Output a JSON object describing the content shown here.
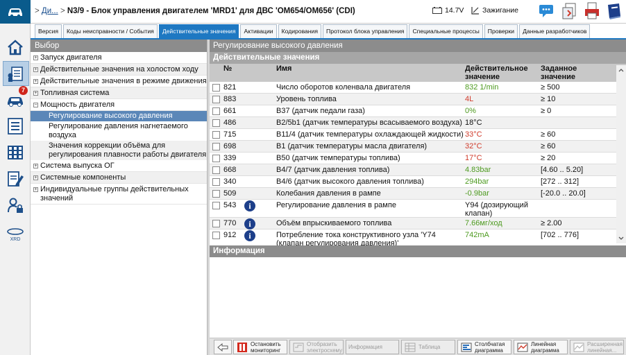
{
  "header": {
    "breadcrumb_sep": ">",
    "breadcrumb_link": "Ди...",
    "breadcrumb_sep2": ">",
    "title": "N3/9 - Блок управления двигателем 'MRD1' для ДВС 'OM654/OM656' (CDI)",
    "voltage": "14.7V",
    "ignition": "Зажигание"
  },
  "nav": {
    "badge_count": "7",
    "xrd_label": "XRD"
  },
  "tabs": [
    "Версия",
    "Коды неисправности / События",
    "Действительные значения",
    "Активации",
    "Кодирования",
    "Протокол блока управления",
    "Специальные процессы",
    "Проверки",
    "Данные разработчиков"
  ],
  "selection": {
    "title": "Выбор",
    "nodes": [
      {
        "label": "Запуск двигателя",
        "toggle": "+"
      },
      {
        "label": "Действительные значения на холостом ходу",
        "toggle": "+"
      },
      {
        "label": "Действительные значения в режиме движения",
        "toggle": "+"
      },
      {
        "label": "Топливная система",
        "toggle": "+"
      },
      {
        "label": "Мощность двигателя",
        "toggle": "−"
      }
    ],
    "children": [
      "Регулирование высокого давления",
      "Регулирование давления нагнетаемого воздуха",
      "Значения коррекции объёма для регулирования плавности работы двигателя"
    ],
    "nodes_after": [
      {
        "label": "Система выпуска ОГ",
        "toggle": "+"
      },
      {
        "label": "Системные компоненты",
        "toggle": "+"
      },
      {
        "label": "Индивидуальные группы действительных значений",
        "toggle": "+"
      }
    ]
  },
  "panel": {
    "title": "Регулирование высокого давления",
    "subtitle": "Действительные значения",
    "columns": {
      "num": "№",
      "name": "Имя",
      "actual": "Действительное значение",
      "target": "Заданное значение"
    }
  },
  "rows": [
    {
      "num": "821",
      "name": "Число оборотов коленвала двигателя",
      "actual": "832 1/min",
      "target": "≥ 500"
    },
    {
      "num": "883",
      "name": "Уровень топлива",
      "actual": "4L",
      "target": "≥ 10"
    },
    {
      "num": "661",
      "name": "B37 (датчик педали газа)",
      "actual": "0%",
      "target": "≥ 0"
    },
    {
      "num": "486",
      "name": "B2/5b1 (датчик температуры всасываемого воздуха)",
      "actual": "18°C",
      "target": ""
    },
    {
      "num": "715",
      "name": "B11/4 (датчик температуры охлаждающей жидкости)",
      "actual": "33°C",
      "target": "≥ 60"
    },
    {
      "num": "698",
      "name": "B1 (датчик температуры масла двигателя)",
      "actual": "32°C",
      "target": "≥ 60"
    },
    {
      "num": "339",
      "name": "B50 (датчик температуры топлива)",
      "actual": "17°C",
      "target": "≥ 20"
    },
    {
      "num": "668",
      "name": "B4/7 (датчик давления топлива)",
      "actual": "4.83bar",
      "target": "[4.60 .. 5.20]"
    },
    {
      "num": "340",
      "name": "B4/6 (датчик высокого давления топлива)",
      "actual": "294bar",
      "target": "[272 .. 312]"
    },
    {
      "num": "509",
      "name": "Колебания давления в рампе",
      "actual": "-0.9bar",
      "target": "[-20.0 .. 20.0]"
    },
    {
      "num": "543",
      "name": "Регулирование давления в рампе",
      "actual": "Y94 (дозирующий клапан)",
      "target": ""
    },
    {
      "num": "770",
      "name": "Объём впрыскиваемого топлива",
      "actual": "7.66мг/ход",
      "target": "≥ 2.00"
    },
    {
      "num": "912",
      "name": "Потребление тока конструктивного узла 'Y74 (клапан регулирования давления)'",
      "actual": "742mA",
      "target": "[702 .. 776]"
    }
  ],
  "info_title": "Информация",
  "toolbar": {
    "stop": "Остановить мониторинг",
    "scheme": "Отобразить электросхему",
    "info": "Информация",
    "table": "Таблица",
    "bar": "Столбчатая диаграмма",
    "line": "Линейная диаграмма",
    "ext": "Расширенная линейная..."
  },
  "colors": {
    "accent": "#1e78c2",
    "ok": "#4d9a1f",
    "warn": "#d03a2a",
    "brand": "#0a5b8c"
  }
}
